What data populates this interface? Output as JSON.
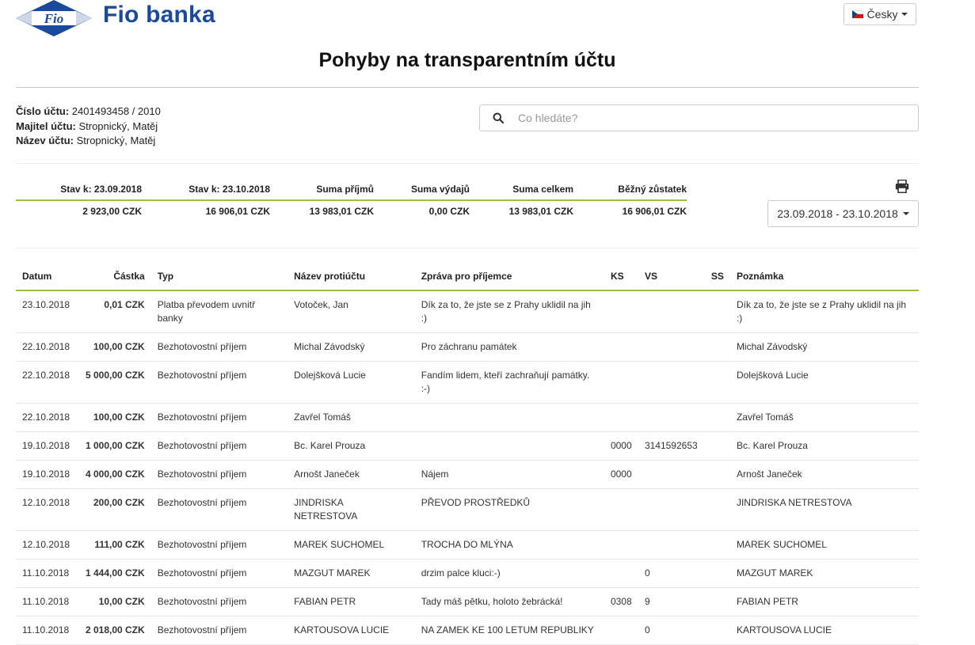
{
  "header": {
    "logo_text": "Fio banka",
    "logo_mark_text": "Fio",
    "language": "Česky",
    "brand_color": "#1a4a9c",
    "accent_color": "#9cc23c"
  },
  "page": {
    "title": "Pohyby na transparentním účtu"
  },
  "account": {
    "number_label": "Číslo účtu:",
    "number": "2401493458 / 2010",
    "owner_label": "Majitel účtu:",
    "owner": "Stropnický, Matěj",
    "name_label": "Název účtu:",
    "name": "Stropnický, Matěj"
  },
  "search": {
    "placeholder": "Co hledáte?",
    "value": ""
  },
  "summary": {
    "headers": [
      "Stav k: 23.09.2018",
      "Stav k: 23.10.2018",
      "Suma příjmů",
      "Suma výdajů",
      "Suma celkem",
      "Běžný zůstatek"
    ],
    "values": [
      "2 923,00 CZK",
      "16 906,01 CZK",
      "13 983,01 CZK",
      "0,00 CZK",
      "13 983,01 CZK",
      "16 906,01 CZK"
    ]
  },
  "date_range": "23.09.2018 - 23.10.2018",
  "table": {
    "columns": [
      "Datum",
      "Částka",
      "Typ",
      "Název protiúčtu",
      "Zpráva pro příjemce",
      "KS",
      "VS",
      "SS",
      "Poznámka"
    ],
    "rows": [
      {
        "date": "23.10.2018",
        "amount": "0,01 CZK",
        "type": "Platba převodem uvnitř banky",
        "counterparty": "Votoček, Jan",
        "message": "Dík za to, že jste se z Prahy uklidil na jih :)",
        "ks": "",
        "vs": "",
        "ss": "",
        "note": "Dík za to, že jste se z Prahy uklidil na jih :)"
      },
      {
        "date": "22.10.2018",
        "amount": "100,00 CZK",
        "type": "Bezhotovostní příjem",
        "counterparty": "Michal Závodský",
        "message": "Pro záchranu památek",
        "ks": "",
        "vs": "",
        "ss": "",
        "note": "Michal Závodský"
      },
      {
        "date": "22.10.2018",
        "amount": "5 000,00 CZK",
        "type": "Bezhotovostní příjem",
        "counterparty": "Dolejšková Lucie",
        "message": "Fandím lidem, kteří zachraňují památky. :-)",
        "ks": "",
        "vs": "",
        "ss": "",
        "note": "Dolejšková Lucie"
      },
      {
        "date": "22.10.2018",
        "amount": "100,00 CZK",
        "type": "Bezhotovostní příjem",
        "counterparty": "Zavřel Tomáš",
        "message": "",
        "ks": "",
        "vs": "",
        "ss": "",
        "note": "Zavřel Tomáš"
      },
      {
        "date": "19.10.2018",
        "amount": "1 000,00 CZK",
        "type": "Bezhotovostní příjem",
        "counterparty": "Bc. Karel Prouza",
        "message": "",
        "ks": "0000",
        "vs": "3141592653",
        "ss": "",
        "note": "Bc. Karel Prouza"
      },
      {
        "date": "19.10.2018",
        "amount": "4 000,00 CZK",
        "type": "Bezhotovostní příjem",
        "counterparty": "Arnošt Janeček",
        "message": "Nájem",
        "ks": "0000",
        "vs": "",
        "ss": "",
        "note": "Arnošt Janeček"
      },
      {
        "date": "12.10.2018",
        "amount": "200,00 CZK",
        "type": "Bezhotovostní příjem",
        "counterparty": "JINDRISKA NETRESTOVA",
        "message": "PŘEVOD PROSTŘEDKŮ",
        "ks": "",
        "vs": "",
        "ss": "",
        "note": "JINDRISKA NETRESTOVA"
      },
      {
        "date": "12.10.2018",
        "amount": "111,00 CZK",
        "type": "Bezhotovostní příjem",
        "counterparty": "MAREK SUCHOMEL",
        "message": "TROCHA DO MLÝNA",
        "ks": "",
        "vs": "",
        "ss": "",
        "note": "MAREK SUCHOMEL"
      },
      {
        "date": "11.10.2018",
        "amount": "1 444,00 CZK",
        "type": "Bezhotovostní příjem",
        "counterparty": "MAZGUT MAREK",
        "message": "drzim palce kluci:-)",
        "ks": "",
        "vs": "0",
        "ss": "",
        "note": "MAZGUT MAREK"
      },
      {
        "date": "11.10.2018",
        "amount": "10,00 CZK",
        "type": "Bezhotovostní příjem",
        "counterparty": "FABIAN PETR",
        "message": "Tady máš pětku, holoto žebrácká!",
        "ks": "0308",
        "vs": "9",
        "ss": "",
        "note": "FABIAN PETR"
      },
      {
        "date": "11.10.2018",
        "amount": "2 018,00 CZK",
        "type": "Bezhotovostní příjem",
        "counterparty": "KARTOUSOVA LUCIE",
        "message": "NA ZAMEK KE 100 LETUM REPUBLIKY",
        "ks": "",
        "vs": "0",
        "ss": "",
        "note": "KARTOUSOVA LUCIE"
      }
    ]
  }
}
